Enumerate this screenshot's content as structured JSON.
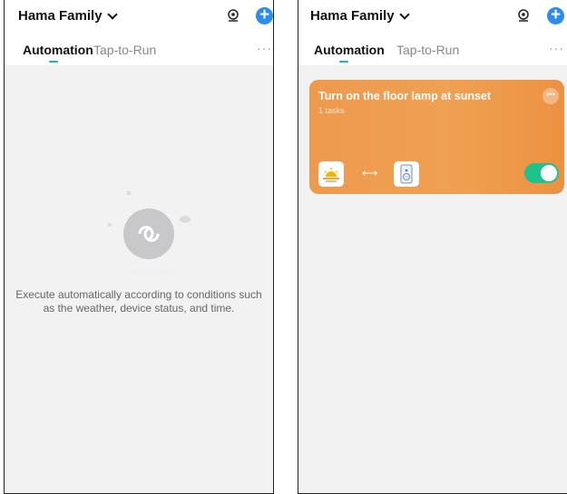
{
  "left_screen": {
    "header": {
      "home_name": "Hama Family"
    },
    "tabs": [
      {
        "label": "Automation",
        "active": true
      },
      {
        "label": "Tap-to-Run",
        "active": false
      }
    ],
    "empty_state": {
      "message": "Execute automatically according to conditions such as the weather, device status, and time."
    }
  },
  "right_screen": {
    "header": {
      "home_name": "Hama Family"
    },
    "tabs": [
      {
        "label": "Automation",
        "active": true
      },
      {
        "label": "Tap-to-Run",
        "active": false
      }
    ],
    "automation_card": {
      "title": "Turn on the floor lamp at sunset",
      "subtitle": "1 tasks",
      "condition_icon": "sunset-icon",
      "task_icon": "smart-plug-icon",
      "enabled": true
    }
  },
  "colors": {
    "accent_tab": "#1fb0c8",
    "add_button": "#2a8cf0",
    "card": "#ee9a4e",
    "toggle_on": "#1fc28a"
  }
}
